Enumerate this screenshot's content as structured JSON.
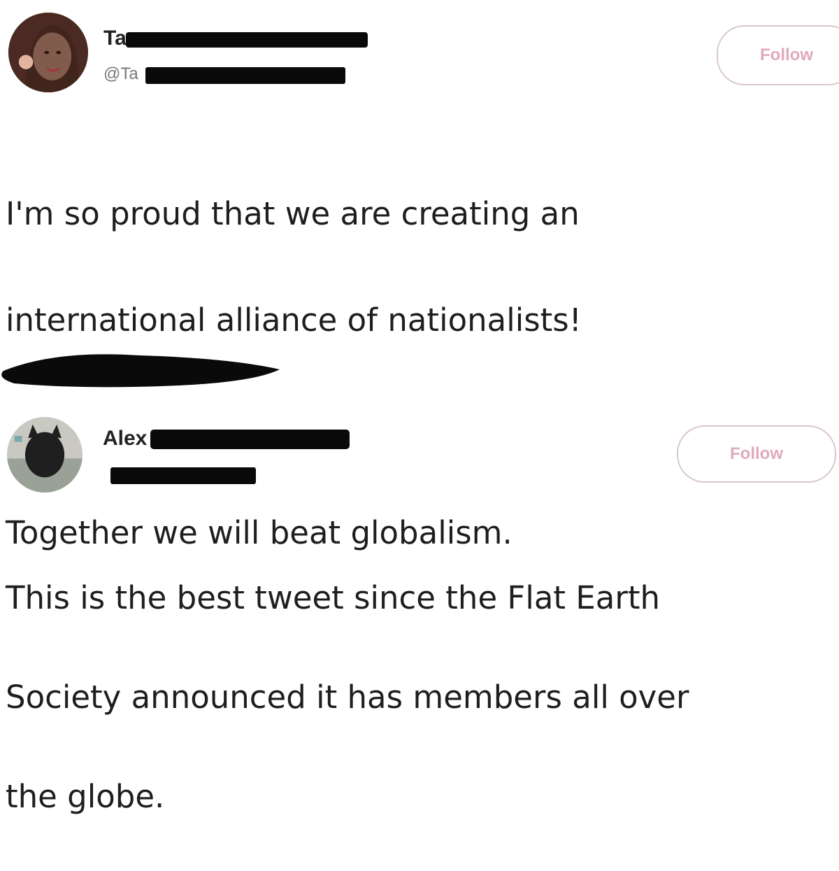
{
  "tweets": [
    {
      "display_name_visible": "Ta",
      "handle_visible": "@Ta",
      "follow_label": "Follow",
      "text_lines": [
        "I'm so proud that we are creating an",
        "international alliance of nationalists!",
        "",
        "Together we will beat globalism."
      ]
    },
    {
      "display_name_visible": "Alex",
      "handle_visible": "",
      "follow_label": "Follow",
      "text_lines": [
        "This is the best tweet since the Flat Earth",
        "Society announced it has members all over",
        "the globe."
      ]
    }
  ],
  "colors": {
    "follow_text": "#e0a9bd",
    "follow_border": "#d9c6cf",
    "redaction": "#0a0a0a"
  },
  "icons": {
    "avatar_1": "profile-photo",
    "avatar_2": "profile-photo"
  }
}
